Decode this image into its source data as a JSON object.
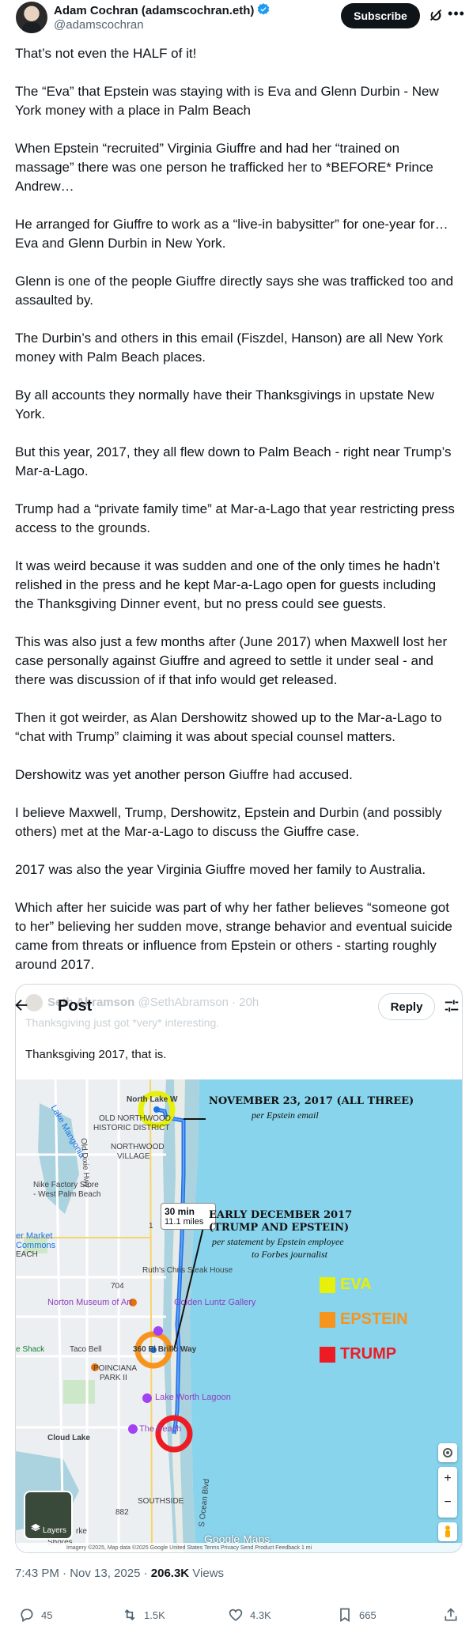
{
  "author": {
    "name": "Adam Cochran (adamscochran.eth)",
    "handle": "@adamscochran",
    "subscribe_label": "Subscribe"
  },
  "tweet": {
    "paragraphs": [
      "That’s not even the HALF of it!",
      "The “Eva” that Epstein was staying with is Eva and Glenn Durbin - New York money with a place in Palm Beach",
      "When Epstein “recruited” Virginia Giuffre and had her “trained on massage” there was one person he trafficked her to *BEFORE* Prince Andrew…",
      "He arranged for Giuffre to work as a “live-in babysitter” for one-year for… Eva and Glenn Durbin in New York.",
      "Glenn is one of the people Giuffre directly says she was trafficked too and assaulted by.",
      "The Durbin’s and others in this email (Fiszdel, Hanson) are all New York money with Palm Beach places.",
      "By all accounts they normally have their Thanksgivings in upstate New York.",
      "But this year, 2017, they all flew down to Palm Beach - right near Trump’s Mar-a-Lago.",
      "Trump had a “private family time” at Mar-a-Lago that year restricting press access to the grounds.",
      "It was weird because it was sudden and one of the only times he hadn’t relished in the press and he kept Mar-a-Lago open for guests including the Thanksgiving Dinner event, but no press could see guests.",
      "This was also just a few months after (June 2017) when Maxwell lost her case personally against Giuffre and agreed to settle it under seal - and there was discussion of if that info would get released.",
      "Then it got weirder, as Alan Dershowitz showed up to the Mar-a-Lago to “chat with Trump” claiming it was about special counsel matters.",
      "Dershowitz was yet another person Giuffre had accused.",
      "I believe Maxwell, Trump, Dershowitz, Epstein and Durbin (and possibly others) met at the Mar-a-Lago to discuss the Giuffre case.",
      "2017 was also the year Virginia Giuffre moved her family to Australia.",
      "Which after her suicide was part of why her father believes “someone got to her” believing her sudden move, strange behavior and eventual suicide came from threats or influence from Epstein or others - starting roughly around 2017."
    ]
  },
  "overlay": {
    "back_icon": "arrow-left-icon",
    "title": "Post",
    "reply_label": "Reply",
    "filter_icon": "sliders-icon"
  },
  "quote": {
    "name": "Seth Abramson",
    "handle": "@SethAbramson · 20h",
    "faded_text": "Thanksgiving just got *very* interesting.",
    "text": "Thanksgiving 2017, that is."
  },
  "map": {
    "annotation1": "NOVEMBER 23, 2017 (ALL THREE)",
    "annotation1_sub": "per Epstein email",
    "annotation2_l1": "EARLY DECEMBER 2017",
    "annotation2_l2": "(TRUMP AND EPSTEIN)",
    "annotation2_sub_l1": "per statement by Epstein employee",
    "annotation2_sub_l2": "to Forbes journalist",
    "legend": [
      {
        "label": "EVA",
        "color": "#e6f00a",
        "text_color": "#e8f000"
      },
      {
        "label": "EPSTEIN",
        "color": "#f7941d",
        "text_color": "#f7941d"
      },
      {
        "label": "TRUMP",
        "color": "#ed1c24",
        "text_color": "#ed1c24"
      }
    ],
    "labels": {
      "north_lake": "North Lake W",
      "old_northwood": "OLD NORTHWOOD",
      "historic": "HISTORIC DISTRICT",
      "northwood": "NORTHWOOD",
      "village": "VILLAGE",
      "lake_mangonia": "Lake Mangonia",
      "nike": "Nike Factory Store",
      "nike2": "- West Palm Beach",
      "market": "er Market",
      "commons": "Commons",
      "each": "EACH",
      "ruths": "Ruth's Chris Steak House",
      "norton": "Norton Museum of Art",
      "golden": "Golden Luntz Gallery",
      "el_brillo": "360 El Brillo Way",
      "shack": "e Shack",
      "taco": "Taco Bell",
      "poinciana": "POINCIANA",
      "park": "PARK II",
      "lake_worth": "Lake Worth Lagoon",
      "peach": "The Peach",
      "cloud_lake": "Cloud Lake",
      "southside": "SOUTHSIDE",
      "shores": "Shores",
      "rke": "rke",
      "ocean_blvd": "S Ocean Blvd",
      "old_dixie": "Old Dixie Hwy",
      "rd704": "704",
      "rd882": "882",
      "rd1": "1"
    },
    "route_time": "30 min",
    "route_dist": "11.1 miles",
    "layers_label": "Layers",
    "google_maps": "Google Maps",
    "footer": "Imagery ©2025, Map data ©2025 Google    United States    Terms    Privacy    Send Product Feedback    1 mi"
  },
  "meta": {
    "time": "7:43 PM · Nov 13, 2025 · ",
    "views": "206.3K",
    "views_label": " Views"
  },
  "actions": {
    "replies": "45",
    "reposts": "1.5K",
    "likes": "4.3K",
    "bookmarks": "665"
  }
}
